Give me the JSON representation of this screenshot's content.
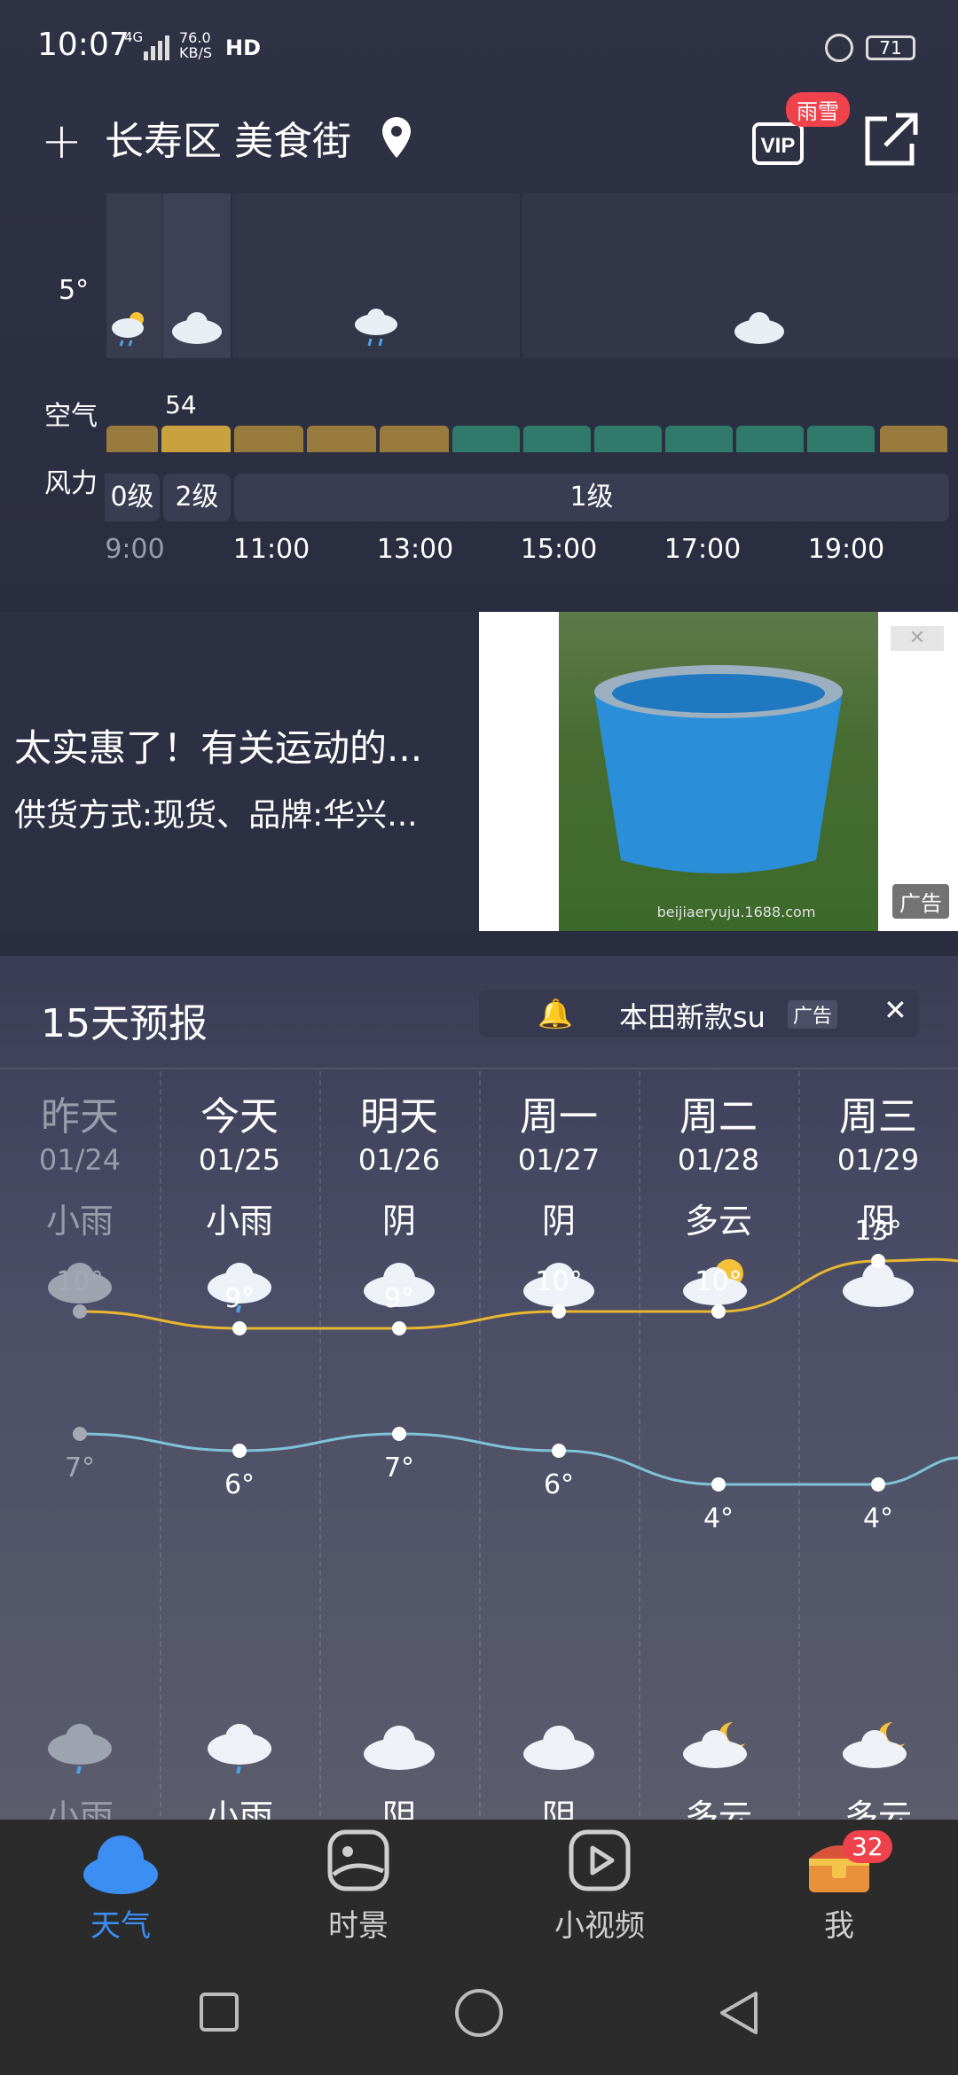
{
  "status": {
    "time": "10:07",
    "network": "4G",
    "speed_value": "76.0",
    "speed_unit": "KB/S",
    "hd": "HD",
    "battery": "71"
  },
  "header": {
    "location": "长寿区 美食街",
    "vip_badge": "雨雪"
  },
  "hourly": {
    "temp_label": "5°",
    "air_label": "空气",
    "aqi_value": "54",
    "wind_label": "风力",
    "wind_levels": [
      "0级",
      "2级",
      "1级"
    ],
    "hours": [
      "9:00",
      "11:00",
      "13:00",
      "15:00",
      "17:00",
      "19:00"
    ]
  },
  "ad": {
    "title": "太实惠了！有关运动的...",
    "subtitle": "供货方式:现货、品牌:华兴...",
    "image_text": "beijiaeryuju.1688.com",
    "tag": "广告",
    "close": "✕"
  },
  "forecast": {
    "title": "15天预报",
    "ad_text": "本田新款su",
    "ad_tag": "广告",
    "ad_close": "✕",
    "days": [
      {
        "name": "昨天",
        "date": "01/24",
        "cond": "小雨",
        "high": "10°",
        "low": "7°",
        "night": "小雨"
      },
      {
        "name": "今天",
        "date": "01/25",
        "cond": "小雨",
        "high": "9°",
        "low": "6°",
        "night": "小雨"
      },
      {
        "name": "明天",
        "date": "01/26",
        "cond": "阴",
        "high": "9°",
        "low": "7°",
        "night": "阴"
      },
      {
        "name": "周一",
        "date": "01/27",
        "cond": "阴",
        "high": "10°",
        "low": "6°",
        "night": "阴"
      },
      {
        "name": "周二",
        "date": "01/28",
        "cond": "多云",
        "high": "10°",
        "low": "4°",
        "night": "多云"
      },
      {
        "name": "周三",
        "date": "01/29",
        "cond": "阴",
        "high": "13°",
        "low": "4°",
        "night": "多云"
      }
    ]
  },
  "tabs": [
    {
      "label": "天气",
      "icon": "cloud-icon"
    },
    {
      "label": "时景",
      "icon": "scenery-icon"
    },
    {
      "label": "小视频",
      "icon": "play-icon"
    },
    {
      "label": "我",
      "icon": "treasure-chest-icon",
      "badge": "32"
    }
  ],
  "colors": {
    "accent": "#3c8ef3",
    "high_line": "#e8b731",
    "low_line": "#7fc3d8",
    "badge": "#f0424c"
  },
  "chart_data": {
    "type": "line",
    "categories": [
      "01/24",
      "01/25",
      "01/26",
      "01/27",
      "01/28",
      "01/29"
    ],
    "series": [
      {
        "values": [
          10,
          9,
          9,
          10,
          10,
          13
        ]
      },
      {
        "values": [
          7,
          6,
          7,
          6,
          4,
          4
        ]
      }
    ]
  }
}
